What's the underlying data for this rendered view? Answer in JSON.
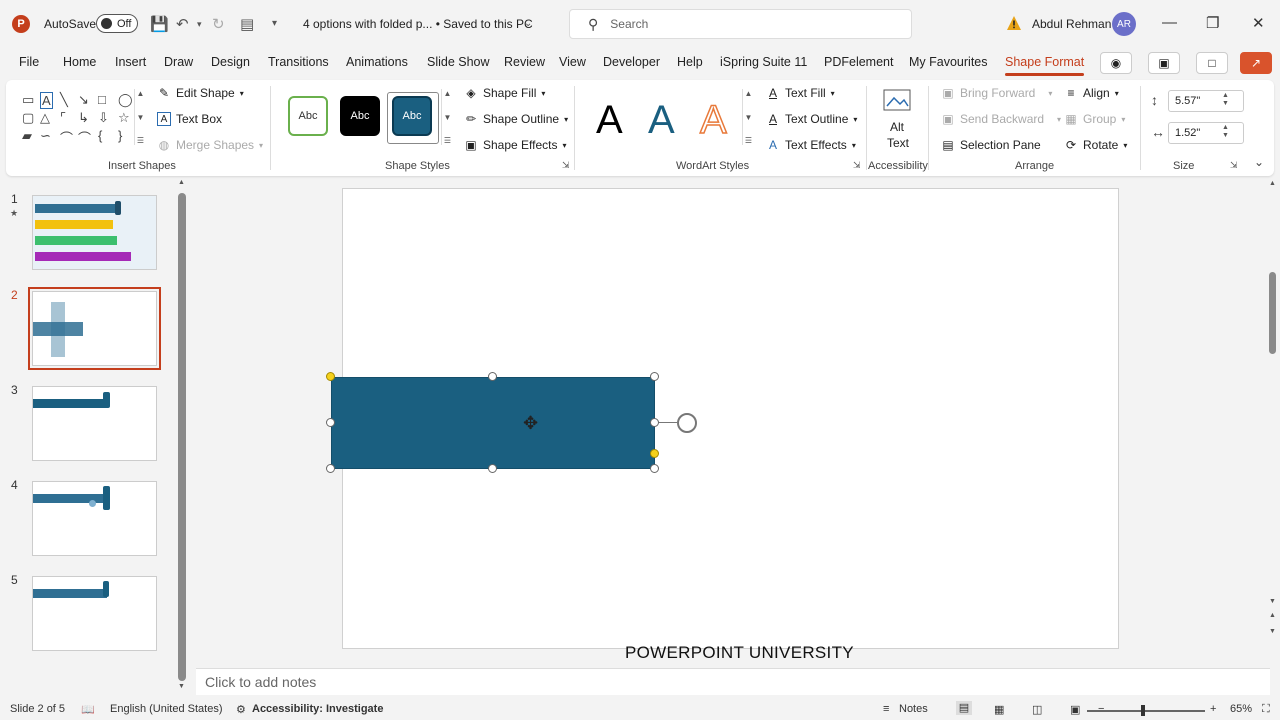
{
  "titlebar": {
    "app_logo": "P",
    "autosave_label": "AutoSave",
    "autosave_state": "Off",
    "doc_title": "4 options with folded p... • Saved to this PC",
    "search_placeholder": "Search",
    "user_name": "Abdul Rehman",
    "user_initials": "AR"
  },
  "tabs": [
    "File",
    "Home",
    "Insert",
    "Draw",
    "Design",
    "Transitions",
    "Animations",
    "Slide Show",
    "Review",
    "View",
    "Developer",
    "Help",
    "iSpring Suite 11",
    "PDFelement",
    "My Favourites",
    "Shape Format"
  ],
  "active_tab": "Shape Format",
  "ribbon": {
    "insert_shapes": {
      "label": "Insert Shapes",
      "edit_shape": "Edit Shape",
      "text_box": "Text Box",
      "merge_shapes": "Merge Shapes"
    },
    "shape_styles": {
      "label": "Shape Styles",
      "preview_text": "Abc",
      "shape_fill": "Shape Fill",
      "shape_outline": "Shape Outline",
      "shape_effects": "Shape Effects"
    },
    "wordart_styles": {
      "label": "WordArt Styles",
      "letter": "A",
      "text_fill": "Text Fill",
      "text_outline": "Text Outline",
      "text_effects": "Text Effects"
    },
    "accessibility": {
      "label": "Accessibility",
      "alt_text_line1": "Alt",
      "alt_text_line2": "Text"
    },
    "arrange": {
      "label": "Arrange",
      "bring_forward": "Bring Forward",
      "send_backward": "Send Backward",
      "selection_pane": "Selection Pane",
      "align": "Align",
      "group": "Group",
      "rotate": "Rotate"
    },
    "size": {
      "label": "Size",
      "height": "5.57\"",
      "width": "1.52\""
    }
  },
  "slides": {
    "numbers": [
      "1",
      "2",
      "3",
      "4",
      "5"
    ],
    "star": "★",
    "selected_index": 2
  },
  "slide": {
    "footer_text": "POWERPOINT UNIVERSITY",
    "shape_color": "#1a5f80"
  },
  "notes_placeholder": "Click to add notes",
  "statusbar": {
    "slide_info": "Slide 2 of 5",
    "language": "English (United States)",
    "accessibility": "Accessibility: Investigate",
    "notes_label": "Notes",
    "zoom": "65%"
  },
  "colors": {
    "accent": "#c43e1c",
    "shape_fill": "#1a5f80"
  }
}
